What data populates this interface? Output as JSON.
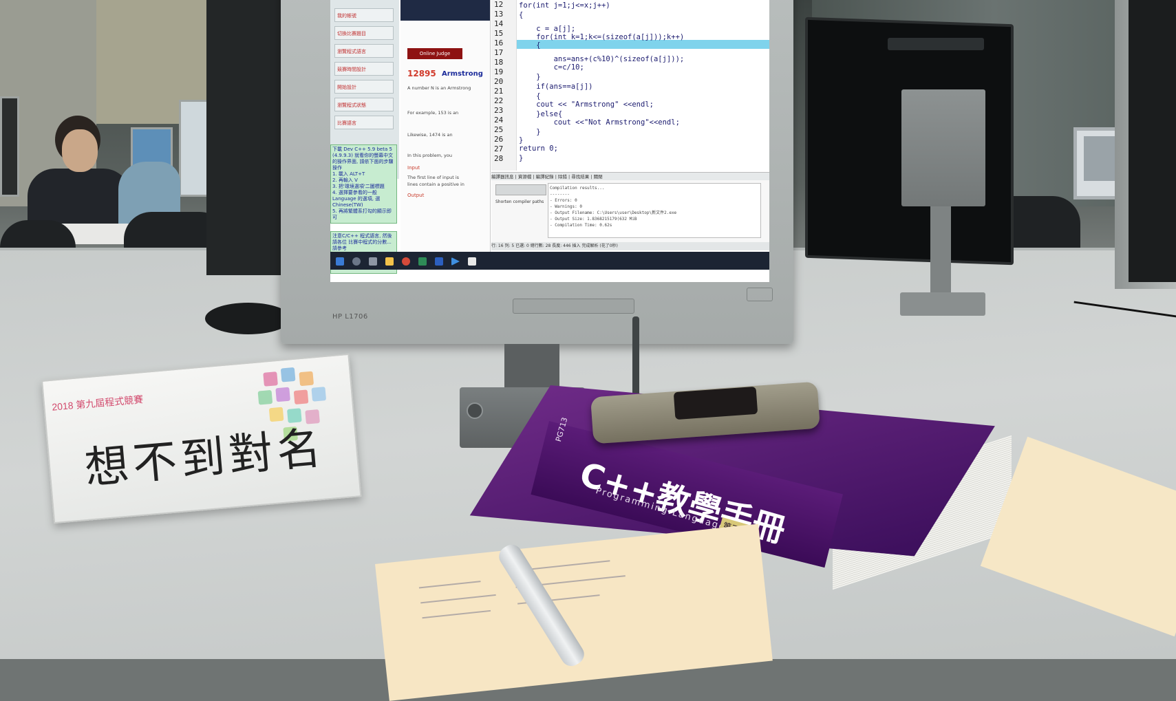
{
  "monitor": {
    "brand_label": "HP L1706"
  },
  "screen": {
    "nav_items": [
      "我的帳號",
      "切換比賽題目",
      "瀏覽程式語言",
      "競賽時間設計",
      "開始設計",
      "瀏覽程式狀態",
      "比賽語言"
    ],
    "note_top": "下載 Dev C++ 5.9 beta 5 (4.9.9.3) 就看你的螢幕中文的操作界面, 請依下面的步驟操作\n1. 載入 ALT+T\n2. 再輸入 V\n3. 把'環境選項'二圖標題\n4. 選擇要參看的一般 Language 的選項, 選 Chinese(TW)\n5. 再將繁體系打勾的顯示即可",
    "note_bottom": "注意C/C++ 程式語言, 然後請各位 比賽中程式的分數... 請參考",
    "judge_badge": "Online Judge",
    "problem_number": "12895",
    "problem_title": "Armstrong",
    "problem_lines": [
      "A number N is an Armstrong",
      "For example, 153 is an",
      "Likewise, 1474 is an",
      "In this problem, you"
    ],
    "input_heading": "Input",
    "input_lines": [
      "The first line of input is",
      "lines contain a positive in"
    ],
    "output_heading": "Output",
    "line_numbers": [
      "12",
      "13",
      "14",
      "15",
      "16",
      "17",
      "18",
      "19",
      "20",
      "21",
      "22",
      "23",
      "24",
      "25",
      "26",
      "27",
      "28"
    ],
    "code_lines": [
      "for(int j=1;j<=x;j++)",
      "{",
      "",
      "    c = a[j];",
      "    for(int k=1;k<=(sizeof(a[j]));k++)",
      "    {",
      "",
      "        ans=ans+(c%10)^(sizeof(a[j]));",
      "        c=c/10;",
      "    }",
      "    if(ans==a[j])",
      "    {",
      "    cout << \"Armstrong\" <<endl;",
      "    }else{",
      "        cout <<\"Not Armstrong\"<<endl;",
      "    }",
      "}",
      "return 0;",
      "}"
    ],
    "tools_tabs": "編譯器訊息 | 資源檔 | 編譯紀錄 | 除錯 | 尋找結果 | 關閉",
    "compile_output": "Compilation results...\n--------\n- Errors: 0\n- Warnings: 0\n- Output Filename: C:\\Users\\user\\Desktop\\新文件2.exe\n- Output Size: 1.8368215179(632 MiB\n- Compilation Time: 0.62s",
    "shorten_paths": "Shorten compiler paths",
    "status_bar": "行:  16   列:  5   已選:  0   總行數:  28   長度:  446   插入   完成解析 (花了0秒)"
  },
  "nameplate": {
    "heading": "2018 第九屆程式競賽",
    "team_name": "想不到對名"
  },
  "book": {
    "title": "C++教學手冊",
    "subtitle": "Programming Language",
    "edition": "第三版",
    "code": "PG713"
  }
}
